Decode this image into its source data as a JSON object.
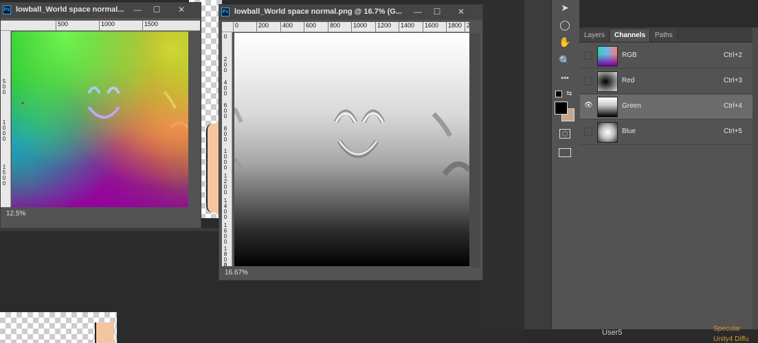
{
  "window1": {
    "title": "lowball_World space normal...",
    "zoom": "12.5%",
    "ruler_h": [
      "500",
      "1000",
      "1500"
    ],
    "ruler_v": [
      "5 0 0",
      "1 0 0 0",
      "1 5 0 0"
    ]
  },
  "window2": {
    "title": "lowball_World space normal.png @ 16.7% (G...",
    "zoom": "16.67%",
    "ruler_h": [
      "0",
      "200",
      "400",
      "600",
      "800",
      "1000",
      "1200",
      "1400",
      "1600",
      "1800",
      "2"
    ],
    "ruler_v": [
      "0",
      "2 0 0",
      "4 0 0",
      "6 0 0",
      "8 0 0",
      "1 0 0 0",
      "1 2 0 0",
      "1 4 0 0",
      "1 6 0 0",
      "1 8 0 0",
      "2"
    ]
  },
  "window_buttons": {
    "minimize": "—",
    "restore": "☐",
    "close": "✕"
  },
  "panel": {
    "tabs": [
      "Layers",
      "Channels",
      "Paths"
    ],
    "active_tab": "Channels",
    "channels": [
      {
        "name": "RGB",
        "shortcut": "Ctrl+2",
        "visible": false
      },
      {
        "name": "Red",
        "shortcut": "Ctrl+3",
        "visible": false
      },
      {
        "name": "Green",
        "shortcut": "Ctrl+4",
        "visible": true
      },
      {
        "name": "Blue",
        "shortcut": "Ctrl+5",
        "visible": false
      }
    ],
    "eye_glyph": "👁"
  },
  "tools": [
    {
      "name": "move-tool-icon",
      "glyph": "➤"
    },
    {
      "name": "ellipse-tool-icon",
      "glyph": "◯"
    },
    {
      "name": "hand-tool-icon",
      "glyph": "✋"
    },
    {
      "name": "zoom-tool-icon",
      "glyph": "🔍"
    },
    {
      "name": "more-tools-icon",
      "glyph": "•••"
    }
  ],
  "colors": {
    "foreground": "#000000",
    "background": "#c9a58a",
    "accent": "#31a8ff"
  },
  "bottom": {
    "layer_label": "User5",
    "shader_label_1": "Specular",
    "shader_label_2": "Unity4 Diffu"
  }
}
